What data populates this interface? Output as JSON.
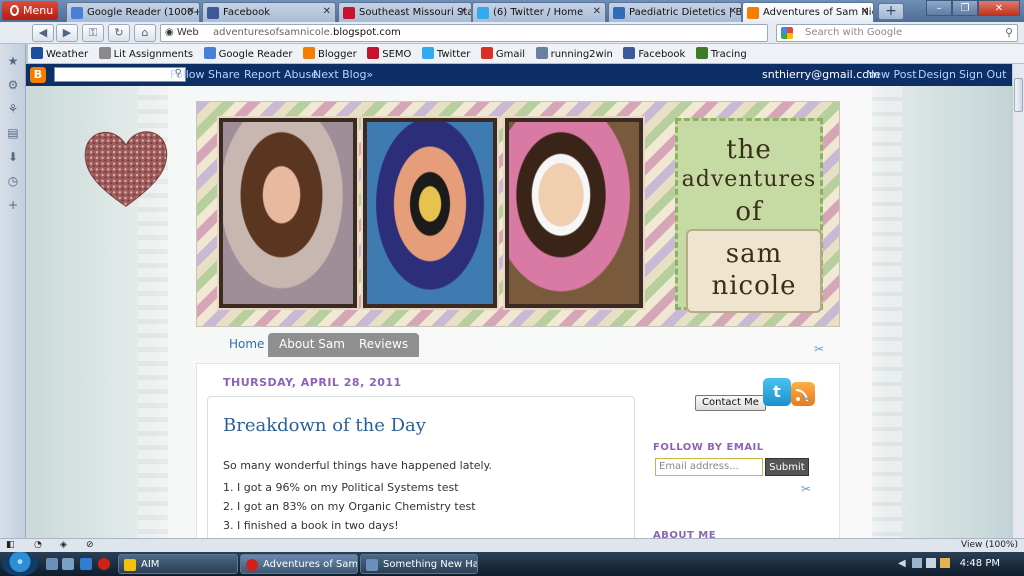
{
  "browser": {
    "menu_label": "Menu",
    "tabs": [
      {
        "label": "Google Reader (1000+)",
        "color": "#4a7fd8"
      },
      {
        "label": "Facebook",
        "color": "#3b5998"
      },
      {
        "label": "Southeast Missouri Sta...",
        "color": "#c4122f"
      },
      {
        "label": "(6) Twitter / Home",
        "color": "#33aaf0"
      },
      {
        "label": "Paediatric Dietetics | Ba...",
        "color": "#2f6db5"
      },
      {
        "label": "Adventures of Sam Nic...",
        "color": "#f57d00"
      }
    ],
    "new_tab_label": "+",
    "address": {
      "web_label": "Web",
      "url_plain": "adventuresofsamnicole.",
      "url_bold": "blogspot.com"
    },
    "search_placeholder": "Search with Google",
    "bookmarks": [
      {
        "label": "Weather",
        "color": "#1b4f9c"
      },
      {
        "label": "Lit Assignments",
        "color": "#8a8a8a"
      },
      {
        "label": "Google Reader",
        "color": "#4a7fd8"
      },
      {
        "label": "Blogger",
        "color": "#f57d00"
      },
      {
        "label": "SEMO",
        "color": "#c4122f"
      },
      {
        "label": "Twitter",
        "color": "#33aaf0"
      },
      {
        "label": "Gmail",
        "color": "#d93025"
      },
      {
        "label": "running2win",
        "color": "#6a7fa0"
      },
      {
        "label": "Facebook",
        "color": "#3b5998"
      },
      {
        "label": "Tracing",
        "color": "#3d7a2a"
      }
    ]
  },
  "blogger_bar": {
    "links": [
      "Follow",
      "Share",
      "Report Abuse",
      "Next Blog»"
    ],
    "user": "snthierry@gmail.com",
    "right_links": [
      "New Post",
      "Design",
      "Sign Out"
    ]
  },
  "banner": {
    "title_lines": [
      "the",
      "adventures",
      "of",
      "sam",
      "nicole"
    ]
  },
  "nav_tabs": [
    "Home",
    "About Sam",
    "Reviews"
  ],
  "post": {
    "date": "THURSDAY, APRIL 28, 2011",
    "title": "Breakdown of the Day",
    "intro": "So many wonderful things have happened lately.",
    "list": [
      "1.  I got a 96% on my Political Systems test",
      "2.  I got an 83% on my Organic Chemistry test",
      "3.  I finished a book in two days!"
    ]
  },
  "sidebar": {
    "contact_label": "Contact Me",
    "follow_heading": "FOLLOW BY EMAIL",
    "email_placeholder": "Email address...",
    "submit_label": "Submit",
    "about_heading": "ABOUT ME"
  },
  "status": {
    "zoom": "View (100%)"
  },
  "taskbar": {
    "tasks": [
      {
        "label": "AIM",
        "color": "#f4c20d"
      },
      {
        "label": "Adventures of Sam ...",
        "color": "#d0201a"
      },
      {
        "label": "Something New Ha...",
        "color": "#6a8fb8"
      }
    ],
    "clock": "4:48 PM"
  }
}
